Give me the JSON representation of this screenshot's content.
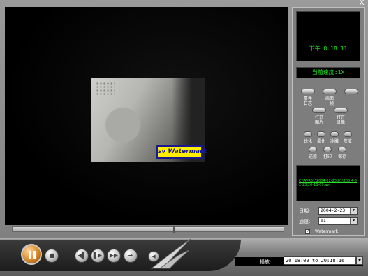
{
  "window": {
    "close_label": "X"
  },
  "video": {
    "watermark_text": "sv  Watermark"
  },
  "panel": {
    "clock": "下午 8:18:11",
    "speed": "当前速度:1X",
    "buttons": [
      {
        "label": "事件\n日志"
      },
      {
        "label": "画面\n一帧"
      },
      {
        "label": ""
      },
      {
        "label": "打开\n图片"
      },
      {
        "label": "打开\n录像"
      }
    ],
    "round_buttons": [
      "锐化",
      "柔化",
      "冰雕",
      "灰度",
      "还原",
      "打印",
      "保存"
    ],
    "file_path": "C:\\AVR51\\2004-02-23\\01\\200 4-02-23,20-18-09.avr",
    "date_label": "日期:",
    "date_value": "2004-2-23",
    "channel_label": "通道:",
    "channel_value": "01",
    "watermark_checkbox": {
      "label": "Watermark",
      "checked": true,
      "mark": "✓"
    }
  },
  "controls": {
    "play_label": "播放:",
    "play_range": "20:18:09 to 20:18:16",
    "icons": [
      "pause-icon",
      "stop-icon",
      "previous-icon",
      "next-icon",
      "fast-forward-icon",
      "forward-icon",
      "volume-icon"
    ]
  },
  "colors": {
    "lcd_green": "#27e027",
    "watermark_bg": "#ffee00",
    "watermark_fg": "#1a1a8a"
  }
}
